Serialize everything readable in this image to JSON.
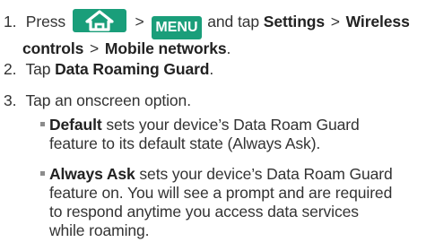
{
  "colors": {
    "key_bg": "#1a9e7a",
    "bullet": "#8c8c8c"
  },
  "step1": {
    "number": "1.",
    "press": "Press",
    "gt1": ">",
    "menu_key": "MENU",
    "and_tap": "and tap",
    "settings": "Settings",
    "gt2": ">",
    "wireless": "Wireless",
    "controls": "controls",
    "gt3": ">",
    "mobile_networks": "Mobile networks",
    "period": "."
  },
  "step2": {
    "number": "2.",
    "tap": "Tap",
    "item": "Data Roaming Guard",
    "period": "."
  },
  "step3": {
    "number": "3.",
    "text": "Tap an onscreen option."
  },
  "options": [
    {
      "term": "Default",
      "line1": "sets your device’s Data Roam Guard",
      "line2": "feature to its default state (Always Ask)."
    },
    {
      "term": "Always Ask",
      "line1": "sets your device’s Data Roam Guard",
      "line2": "feature on. You will see a prompt and are required",
      "line3": "to respond anytime you access data services",
      "line4": "while roaming."
    }
  ]
}
